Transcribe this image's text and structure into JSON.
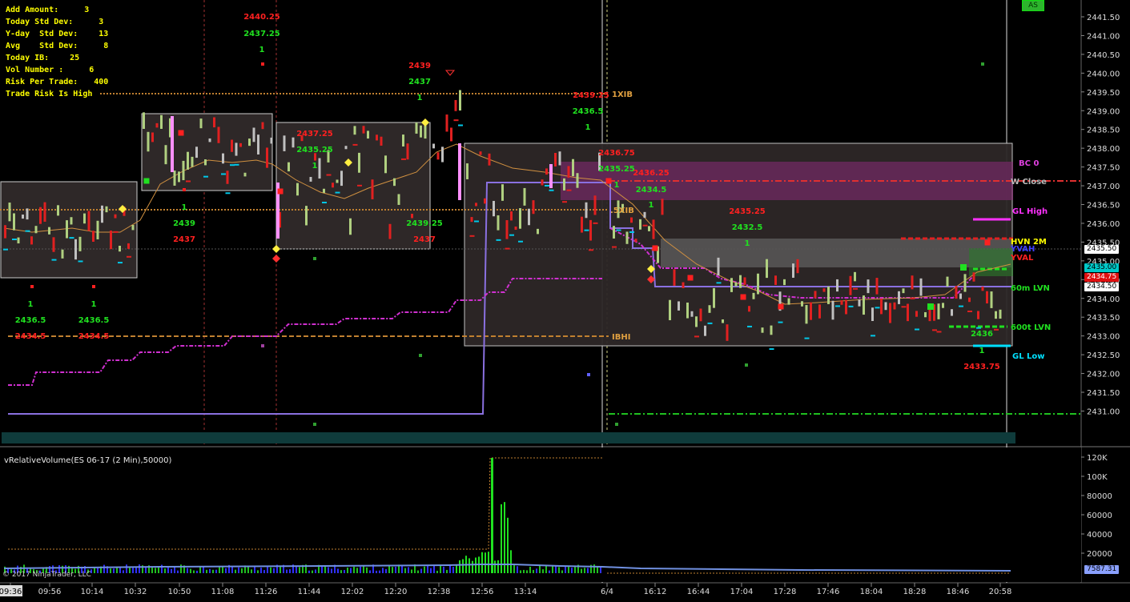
{
  "stats": [
    {
      "label": "Add Amount:",
      "value": "3"
    },
    {
      "label": "Today Std Dev:",
      "value": "3"
    },
    {
      "label": "Y-day  Std Dev:",
      "value": "13"
    },
    {
      "label": "Avg    Std Dev:",
      "value": "8"
    },
    {
      "label": "Today IB:",
      "value": "25"
    },
    {
      "label": "Vol Number :",
      "value": "6"
    },
    {
      "label": "Risk Per Trade:",
      "value": "400"
    },
    {
      "label": "Trade Risk Is High",
      "value": ""
    }
  ],
  "badge": "AS",
  "indicator_label": "vRelativeVolume(ES 06-17 (2 Min),50000)",
  "copyright": "© 2017 NinjaTrader, LLC",
  "price_axis": [
    "2441.50",
    "2441.00",
    "2440.50",
    "2440.00",
    "2439.50",
    "2439.00",
    "2438.50",
    "2438.00",
    "2437.50",
    "2437.00",
    "2436.50",
    "2436.00",
    "2435.50",
    "2435.00",
    "2434.50",
    "2434.00",
    "2433.50",
    "2433.00",
    "2432.50",
    "2432.00",
    "2431.50",
    "2431.00"
  ],
  "price_tags": [
    {
      "text": "2435.50",
      "bg": "#ffffff",
      "fg": "#000000"
    },
    {
      "text": "2435.00",
      "bg": "#00c8c8",
      "fg": "#000000"
    },
    {
      "text": "2434.75",
      "bg": "#e01010",
      "fg": "#ffffff"
    },
    {
      "text": "2434.50",
      "bg": "#ffffff",
      "fg": "#000000"
    }
  ],
  "volume_axis": [
    "120K",
    "100K",
    "80000",
    "60000",
    "40000",
    "20000"
  ],
  "volume_tag": "7587.31",
  "time_axis": [
    "09:36",
    "09:56",
    "10:14",
    "10:32",
    "10:50",
    "11:08",
    "11:26",
    "11:44",
    "12:02",
    "12:20",
    "12:38",
    "12:56",
    "13:14",
    "6/4",
    "16:12",
    "16:44",
    "17:04",
    "17:28",
    "17:46",
    "18:04",
    "18:28",
    "18:46",
    "20:58"
  ],
  "level_labels": [
    {
      "text": "1XIB",
      "color": "#e0a040"
    },
    {
      "text": ".5XIB",
      "color": "#e0a040"
    },
    {
      "text": "IBHI",
      "color": "#e0a040"
    },
    {
      "text": "BC 0",
      "color": "#e040e0"
    },
    {
      "text": "W Close",
      "color": "#bbbbbb"
    },
    {
      "text": "GL High",
      "color": "#ff30ff"
    },
    {
      "text": "HVN 2M",
      "color": "#ffff00"
    },
    {
      "text": "YVAH",
      "color": "#4040ff"
    },
    {
      "text": "YVAL",
      "color": "#ff2020"
    },
    {
      "text": "60m LVN",
      "color": "#20e020"
    },
    {
      "text": "600t LVN",
      "color": "#20e020"
    },
    {
      "text": "GL Low",
      "color": "#00e0ff"
    }
  ],
  "annotations": [
    {
      "text": "2440.25",
      "color": "#ff2020"
    },
    {
      "text": "2437.25",
      "color": "#20e020"
    },
    {
      "text": "1",
      "color": "#20e020"
    },
    {
      "text": "2439",
      "color": "#ff2020"
    },
    {
      "text": "2437",
      "color": "#20e020"
    },
    {
      "text": "1",
      "color": "#20e020"
    },
    {
      "text": "2439.25",
      "color": "#ff2020"
    },
    {
      "text": "2436.5",
      "color": "#20e020"
    },
    {
      "text": "1",
      "color": "#20e020"
    },
    {
      "text": "2437.25",
      "color": "#ff2020"
    },
    {
      "text": "2435.25",
      "color": "#20e020"
    },
    {
      "text": "1",
      "color": "#20e020"
    },
    {
      "text": "1",
      "color": "#20e020"
    },
    {
      "text": "2439",
      "color": "#20e020"
    },
    {
      "text": "2437",
      "color": "#ff2020"
    },
    {
      "text": "2439.25",
      "color": "#20e020"
    },
    {
      "text": "2437",
      "color": "#ff2020"
    },
    {
      "text": "1",
      "color": "#20e020"
    },
    {
      "text": "1",
      "color": "#20e020"
    },
    {
      "text": "2436.5",
      "color": "#20e020"
    },
    {
      "text": "2436.5",
      "color": "#20e020"
    },
    {
      "text": "2434.5",
      "color": "#ff2020"
    },
    {
      "text": "2434.5",
      "color": "#ff2020"
    },
    {
      "text": "2436.75",
      "color": "#ff2020"
    },
    {
      "text": "2435.25",
      "color": "#20e020"
    },
    {
      "text": "1",
      "color": "#20e020"
    },
    {
      "text": "2436.25",
      "color": "#ff2020"
    },
    {
      "text": "2434.5",
      "color": "#20e020"
    },
    {
      "text": "1",
      "color": "#20e020"
    },
    {
      "text": "2435.25",
      "color": "#ff2020"
    },
    {
      "text": "2432.5",
      "color": "#20e020"
    },
    {
      "text": "1",
      "color": "#20e020"
    },
    {
      "text": "2436",
      "color": "#20e020"
    },
    {
      "text": "1",
      "color": "#20e020"
    },
    {
      "text": "2433.75",
      "color": "#ff2020"
    }
  ]
}
